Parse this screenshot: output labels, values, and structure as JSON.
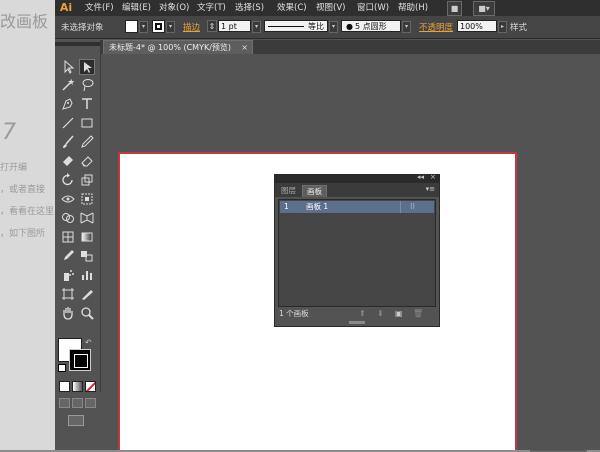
{
  "menubar": {
    "logo": "Ai",
    "items": [
      "文件(F)",
      "编辑(E)",
      "对象(O)",
      "文字(T)",
      "选择(S)",
      "效果(C)",
      "视图(V)",
      "窗口(W)",
      "帮助(H)"
    ],
    "right_buttons": [
      "■",
      "■▾"
    ]
  },
  "control_bar": {
    "selection_status": "未选择对象",
    "stroke_link": "描边",
    "stroke_weight": "1 pt",
    "stroke_profile": "等比",
    "brush": "5 点圆形",
    "opacity_link": "不透明度",
    "opacity_value": "100%",
    "style_label": "样式"
  },
  "document": {
    "tab_title": "未标题-4* @ 100% (CMYK/预览)",
    "close_glyph": "×"
  },
  "artboards_panel": {
    "tabs": [
      "图层",
      "画板"
    ],
    "active_tab": 1,
    "collapse_glyph": "◂◂",
    "close_glyph": "×",
    "menu_glyph": "▾≡",
    "rows": [
      {
        "number": "1",
        "name": "画板 1"
      }
    ],
    "footer_count": "1 个画板"
  },
  "background": {
    "texts": [
      "改画板",
      "打开编",
      "，或者直接",
      "，看看在这里",
      "，如下图所",
      "7"
    ]
  },
  "colors": {
    "accent": "#e8a23a",
    "artboard_border": "#c0393b",
    "selected_row": "#5d6f8e"
  }
}
